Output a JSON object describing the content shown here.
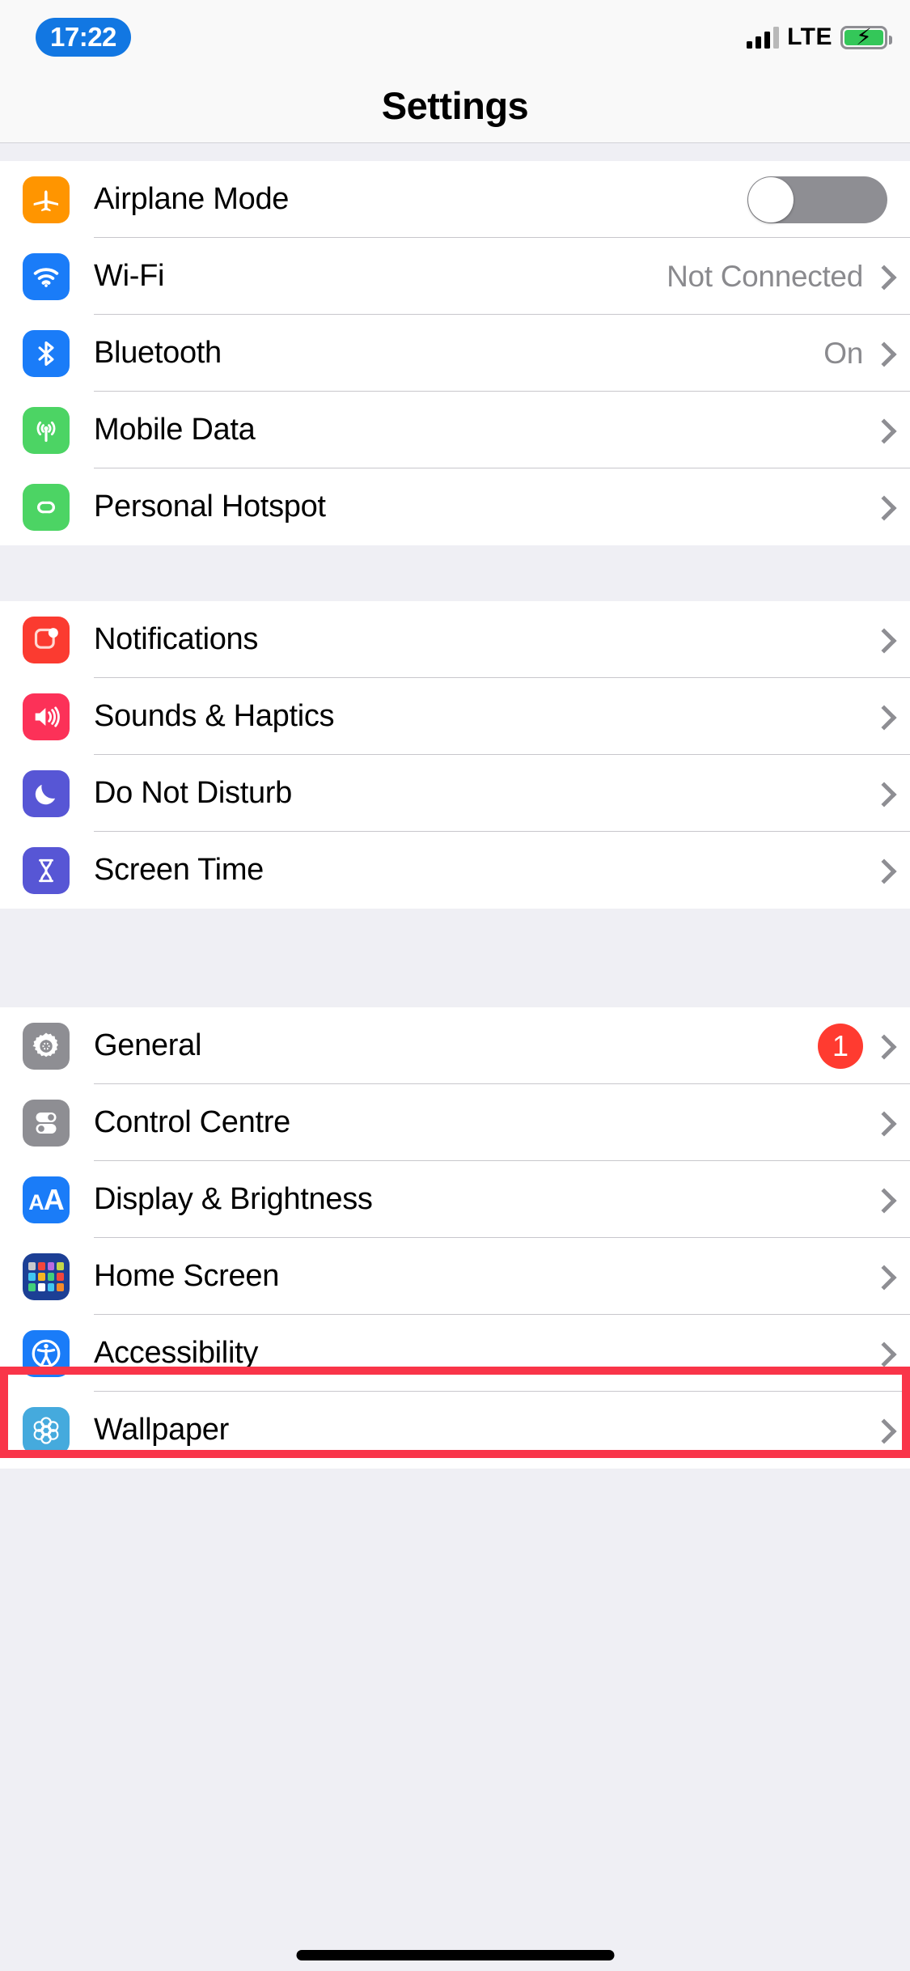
{
  "status_bar": {
    "time": "17:22",
    "network_type": "LTE",
    "signal_bars_filled": 3,
    "signal_bars_total": 4,
    "battery_charging": true,
    "battery_color": "#34c759",
    "time_pill_color": "#1277e2"
  },
  "header": {
    "title": "Settings"
  },
  "groups": [
    {
      "rows": [
        {
          "label": "Airplane Mode",
          "icon": "airplane-icon",
          "control": "toggle",
          "toggle_on": false
        },
        {
          "label": "Wi-Fi",
          "icon": "wifi-icon",
          "value": "Not Connected",
          "control": "chevron"
        },
        {
          "label": "Bluetooth",
          "icon": "bluetooth-icon",
          "value": "On",
          "control": "chevron"
        },
        {
          "label": "Mobile Data",
          "icon": "cellular-icon",
          "value": "",
          "control": "chevron"
        },
        {
          "label": "Personal Hotspot",
          "icon": "hotspot-icon",
          "value": "",
          "control": "chevron"
        }
      ]
    },
    {
      "rows": [
        {
          "label": "Notifications",
          "icon": "notifications-icon",
          "value": "",
          "control": "chevron"
        },
        {
          "label": "Sounds & Haptics",
          "icon": "sounds-icon",
          "value": "",
          "control": "chevron"
        },
        {
          "label": "Do Not Disturb",
          "icon": "moon-icon",
          "value": "",
          "control": "chevron"
        },
        {
          "label": "Screen Time",
          "icon": "hourglass-icon",
          "value": "",
          "control": "chevron"
        }
      ]
    },
    {
      "rows": [
        {
          "label": "General",
          "icon": "gear-icon",
          "badge": "1",
          "control": "chevron",
          "highlighted": true
        },
        {
          "label": "Control Centre",
          "icon": "control-centre-icon",
          "value": "",
          "control": "chevron"
        },
        {
          "label": "Display & Brightness",
          "icon": "display-brightness-icon",
          "value": "",
          "control": "chevron"
        },
        {
          "label": "Home Screen",
          "icon": "home-screen-icon",
          "value": "",
          "control": "chevron"
        },
        {
          "label": "Accessibility",
          "icon": "accessibility-icon",
          "value": "",
          "control": "chevron"
        },
        {
          "label": "Wallpaper",
          "icon": "wallpaper-icon",
          "value": "",
          "control": "chevron"
        }
      ]
    }
  ],
  "annotation": {
    "highlight_color": "#f93549",
    "highlight_target": "General",
    "badge_color": "#ff3b30"
  }
}
